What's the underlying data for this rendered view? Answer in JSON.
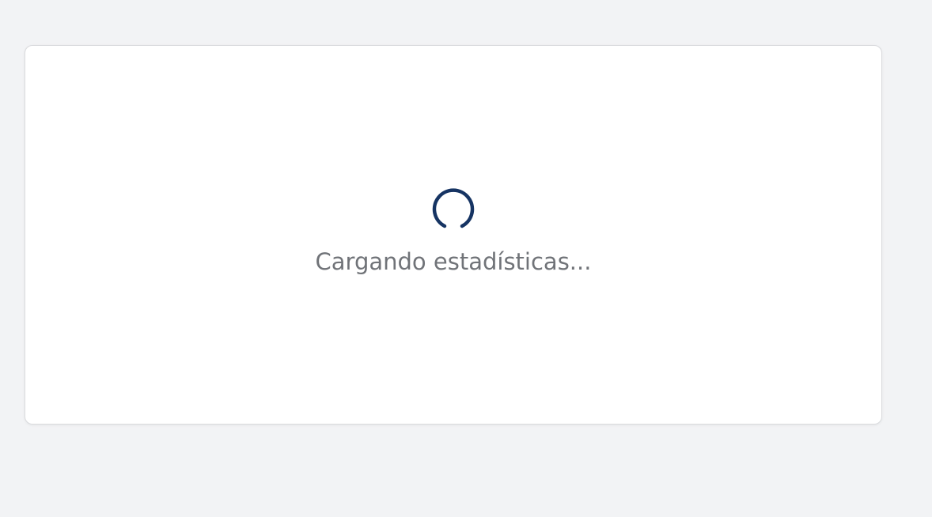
{
  "colors": {
    "page_background": "#f2f3f5",
    "card_background": "#ffffff",
    "card_border": "#d9dadd",
    "spinner": "#163463",
    "text_muted": "#707378"
  },
  "loading": {
    "icon": "spinner-icon",
    "text": "Cargando estadísticas..."
  }
}
